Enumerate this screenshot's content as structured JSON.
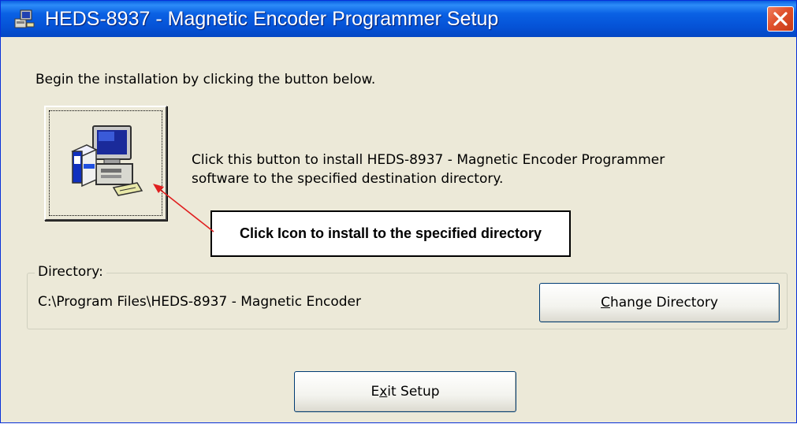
{
  "window": {
    "title": "HEDS-8937 - Magnetic Encoder Programmer Setup",
    "icon": "installer-computer-icon",
    "close_icon": "close-icon",
    "colors": {
      "titlebar": "#0553d7",
      "body": "#ece9d8",
      "close": "#e0502c",
      "annotation_arrow": "#e02020"
    }
  },
  "intro_text": "Begin the installation by clicking the button below.",
  "install": {
    "button_icon": "install-computer-icon",
    "description_line1": "Click this button to install HEDS-8937 - Magnetic Encoder Programmer",
    "description_line2": "software to the specified destination directory."
  },
  "annotation": {
    "callout_text": "Click Icon to install to the specified directory"
  },
  "directory": {
    "group_label": "Directory:",
    "path": "C:\\Program Files\\HEDS-8937 - Magnetic Encoder",
    "change_button": {
      "prefix": "",
      "mnemonic": "C",
      "suffix": "hange Directory"
    }
  },
  "exit_button": {
    "prefix": "E",
    "mnemonic": "x",
    "suffix": "it Setup"
  }
}
